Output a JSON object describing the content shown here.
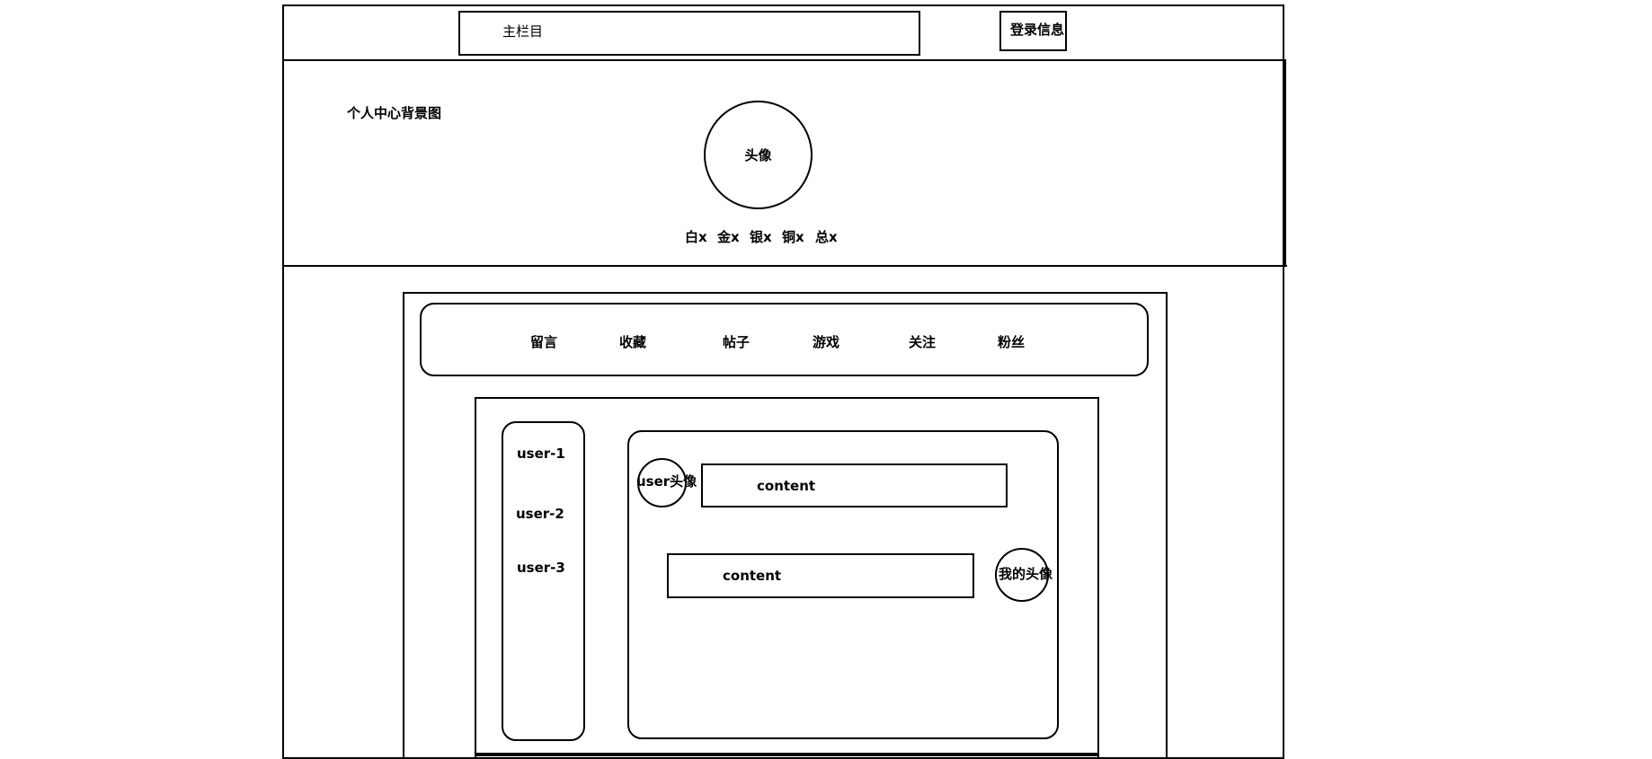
{
  "header": {
    "main_nav_label": "主栏目",
    "login_label": "登录信息"
  },
  "banner": {
    "background_label": "个人中心背景图",
    "avatar_label": "头像",
    "stats": [
      "白x",
      "金x",
      "银x",
      "铜x",
      "总x"
    ]
  },
  "tabs": [
    "留言",
    "收藏",
    "帖子",
    "游戏",
    "关注",
    "粉丝"
  ],
  "sidebar": {
    "users": [
      "user-1",
      "user-2",
      "user-3"
    ]
  },
  "chat": {
    "incoming": {
      "avatar_label": "user头像",
      "content": "content"
    },
    "outgoing": {
      "avatar_label": "我的头像",
      "content": "content"
    }
  }
}
